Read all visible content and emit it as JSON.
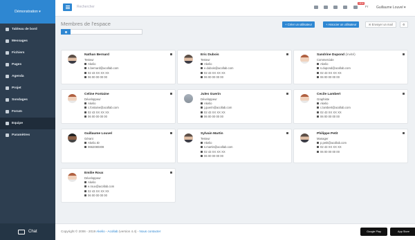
{
  "sidebar": {
    "space_label": "Démonstration ▾",
    "items": [
      {
        "label": "Tableau de bord",
        "icon": "dashboard-icon"
      },
      {
        "label": "Messages",
        "icon": "envelope-icon"
      },
      {
        "label": "Fichiers",
        "icon": "folder-icon"
      },
      {
        "label": "Pages",
        "icon": "file-icon"
      },
      {
        "label": "Agenda",
        "icon": "calendar-icon"
      },
      {
        "label": "Projet",
        "icon": "tasks-icon"
      },
      {
        "label": "Sondages",
        "icon": "chart-icon"
      },
      {
        "label": "Forum",
        "icon": "comments-icon"
      },
      {
        "label": "Equipe",
        "icon": "users-icon",
        "active": true
      },
      {
        "label": "Paramètres",
        "icon": "gear-icon"
      }
    ],
    "chat_label": "Chat"
  },
  "topbar": {
    "search_placeholder": "Rechercher",
    "notification_badge": "NEW",
    "language": "Fr",
    "user_name": "Guillaume Louvel ▾"
  },
  "page": {
    "title": "Membres de l'espace",
    "actions": {
      "create_user": "+ Créer un utilisateur",
      "associate_user": "+ Associer un utilisateur",
      "send_email": "✉ Envoyer un mail"
    }
  },
  "members": [
    {
      "name": "Nathan Bernard",
      "invited": "",
      "role": "Testeur",
      "company": "Akelio",
      "email": "n.bernard@acollab.com",
      "phone": "02 43 XX XX XX",
      "mobile": "06 00 00 00 00",
      "avatar": "m"
    },
    {
      "name": "Eric Dubois",
      "invited": "",
      "role": "Testeur",
      "company": "Akelio",
      "email": "e.dubois@acollab.com",
      "phone": "02 43 XX XX XX",
      "mobile": "06 00 00 00 00",
      "avatar": "m"
    },
    {
      "name": "Sandrine Dupond",
      "invited": "(invité)",
      "role": "Commerciale",
      "company": "Akelio",
      "email": "s.dupond@acollab.com",
      "phone": "02 43 XX XX XX",
      "mobile": "06 00 00 00 00",
      "avatar": "f"
    },
    {
      "name": "Celine Fontaine",
      "invited": "",
      "role": "Développeur",
      "company": "Akelio",
      "email": "c.fontaine@acollab.com",
      "phone": "02 43 XX XX XX",
      "mobile": "06 00 00 00 00",
      "avatar": "f"
    },
    {
      "name": "Jules Guerin",
      "invited": "",
      "role": "Développeur",
      "company": "Akelio",
      "email": "j.guerin@acollab.com",
      "phone": "02 43 XX XX XX",
      "mobile": "06 00 00 00 00",
      "avatar": "g"
    },
    {
      "name": "Cecile Lambert",
      "invited": "",
      "role": "Graphiste",
      "company": "Akelio",
      "email": "c.lambert@acollab.com",
      "phone": "02 43 XX XX XX",
      "mobile": "06 00 00 00 00",
      "avatar": "f"
    },
    {
      "name": "Guillaume Louvel",
      "invited": "",
      "role": "Gérant",
      "company": "Akelio.ID",
      "email": "",
      "phone": "0662080308",
      "mobile": "",
      "avatar": "d"
    },
    {
      "name": "Sylvain Martin",
      "invited": "",
      "role": "Testeur",
      "company": "Akelio",
      "email": "s.martin@acollab.com",
      "phone": "02 43 XX XX XX",
      "mobile": "06 00 00 00 00",
      "avatar": "m"
    },
    {
      "name": "Philippe Petit",
      "invited": "",
      "role": "Manager",
      "company": "",
      "email": "p.petit@acollab.com",
      "phone": "02 43 XX XX XX",
      "mobile": "06 00 00 00 00",
      "avatar": "m"
    },
    {
      "name": "Emilie Roux",
      "invited": "",
      "role": "Développeur",
      "company": "Akelio",
      "email": "e.roux@acollab.com",
      "phone": "02 43 XX XX XX",
      "mobile": "06 00 00 00 00",
      "avatar": "f"
    }
  ],
  "footer": {
    "copyright": "Copyright © 2006 - 2019",
    "brand": "Akelio",
    "product": "Acollab",
    "version": "(version 4.4)",
    "separator": "-",
    "contact": "Nous contacter",
    "google_play": "Google Play",
    "app_store": "App Store"
  },
  "colors": {
    "accent": "#2e87d2",
    "sidebar": "#2d3e50"
  }
}
